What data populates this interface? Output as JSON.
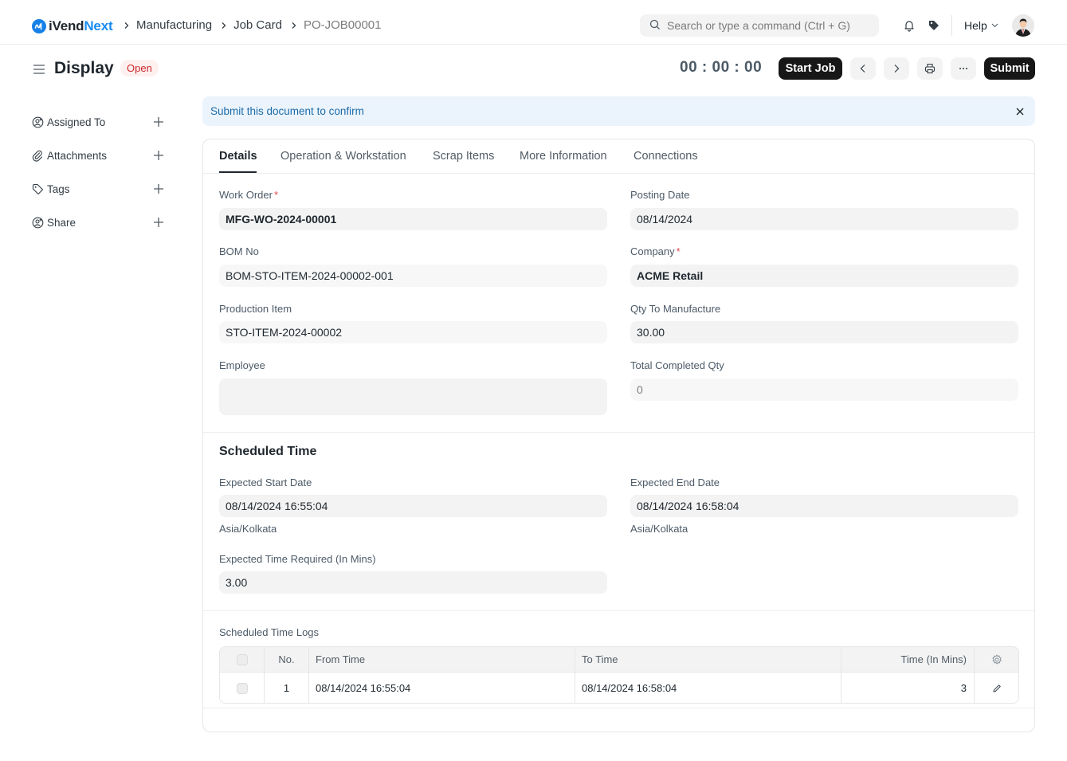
{
  "navbar": {
    "brand_prefix": "iVend",
    "brand_suffix": "Next",
    "breadcrumbs": [
      "Manufacturing",
      "Job Card",
      "PO-JOB00001"
    ],
    "search_placeholder": "Search or type a command (Ctrl + G)",
    "help_label": "Help",
    "icons": [
      "bell-icon",
      "tag-icon",
      "chevron-down-icon",
      "avatar"
    ]
  },
  "page": {
    "title": "Display",
    "status": "Open",
    "timer": "00 : 00 : 00",
    "start_job_label": "Start Job",
    "submit_label": "Submit"
  },
  "sidebar": {
    "items": [
      {
        "label": "Assigned To",
        "icon": "assign-user-icon"
      },
      {
        "label": "Attachments",
        "icon": "paperclip-icon"
      },
      {
        "label": "Tags",
        "icon": "tag-icon"
      },
      {
        "label": "Share",
        "icon": "share-user-icon"
      }
    ]
  },
  "alert": {
    "message": "Submit this document to confirm"
  },
  "tabs": [
    "Details",
    "Operation & Workstation",
    "Scrap Items",
    "More Information",
    "Connections"
  ],
  "active_tab": "Details",
  "details": {
    "left": [
      {
        "label": "Work Order",
        "required": "*",
        "value": "MFG-WO-2024-00001"
      },
      {
        "label": "BOM No",
        "value": "BOM-STO-ITEM-2024-00002-001"
      },
      {
        "label": "Production Item",
        "value": "STO-ITEM-2024-00002"
      },
      {
        "label": "Employee",
        "value": ""
      }
    ],
    "right": [
      {
        "label": "Posting Date",
        "value": "08/14/2024"
      },
      {
        "label": "Company",
        "required": "*",
        "value": "ACME Retail"
      },
      {
        "label": "Qty To Manufacture",
        "value": "30.00"
      },
      {
        "label": "Total Completed Qty",
        "value": "0"
      }
    ]
  },
  "scheduled_time": {
    "title": "Scheduled Time",
    "expected_start_label": "Expected Start Date",
    "expected_start_value": "08/14/2024 16:55:04",
    "expected_start_tz": "Asia/Kolkata",
    "expected_end_label": "Expected End Date",
    "expected_end_value": "08/14/2024 16:58:04",
    "expected_end_tz": "Asia/Kolkata",
    "time_required_label": "Expected Time Required (In Mins)",
    "time_required_value": "3.00"
  },
  "time_logs": {
    "label": "Scheduled Time Logs",
    "columns": [
      "No.",
      "From Time",
      "To Time",
      "Time (In Mins)"
    ],
    "rows": [
      {
        "no": "1",
        "from_time": "08/14/2024 16:55:04",
        "to_time": "08/14/2024 16:58:04",
        "time_in_mins": "3"
      }
    ]
  }
}
